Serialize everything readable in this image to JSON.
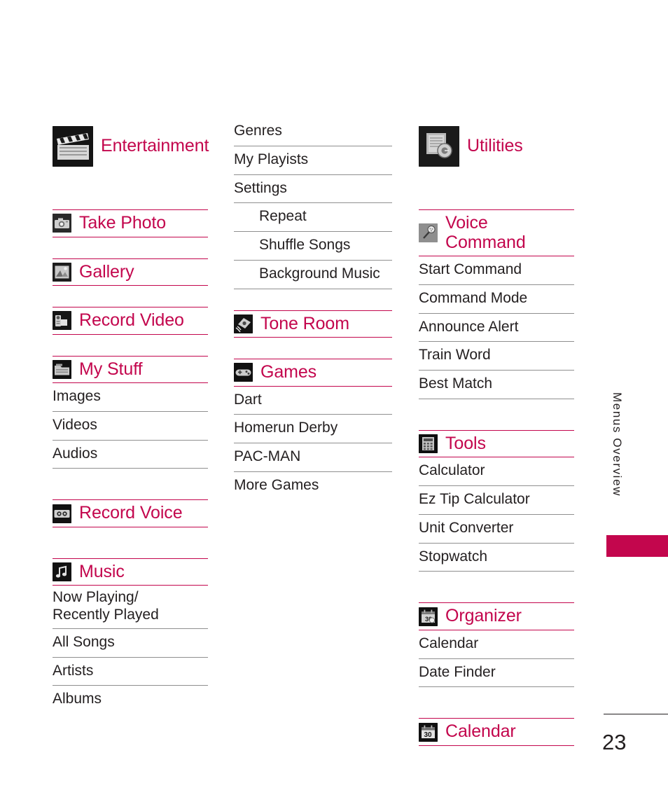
{
  "page": {
    "number": "23",
    "side_label": "Menus Overview",
    "accent_color": "#c3064d",
    "text_color": "#231f20"
  },
  "columns": {
    "left": {
      "sections": [
        {
          "type": "header",
          "size": "large",
          "icon": "clapperboard-icon",
          "title": "Entertainment",
          "rules": "none"
        },
        {
          "type": "header",
          "size": "small",
          "icon": "camera-icon",
          "title": "Take Photo",
          "rules": "both"
        },
        {
          "type": "header",
          "size": "small",
          "icon": "gallery-icon",
          "title": "Gallery",
          "rules": "both"
        },
        {
          "type": "header",
          "size": "small",
          "icon": "camcorder-icon",
          "title": "Record Video",
          "rules": "both"
        },
        {
          "type": "header",
          "size": "small",
          "icon": "folder-icon",
          "title": "My Stuff",
          "rules": "both"
        },
        {
          "type": "items",
          "items": [
            {
              "label": "Images",
              "indent": false
            },
            {
              "label": "Videos",
              "indent": false
            },
            {
              "label": "Audios",
              "indent": false
            }
          ]
        },
        {
          "type": "header",
          "size": "small",
          "icon": "cassette-icon",
          "title": "Record Voice",
          "rules": "both"
        },
        {
          "type": "header",
          "size": "small",
          "icon": "music-note-icon",
          "title": "Music",
          "rules": "both"
        },
        {
          "type": "items",
          "items": [
            {
              "label": "Now Playing/\nRecently Played",
              "indent": false
            },
            {
              "label": "All Songs",
              "indent": false
            },
            {
              "label": "Artists",
              "indent": false
            },
            {
              "label": "Albums",
              "indent": false
            }
          ]
        }
      ]
    },
    "middle": {
      "sections": [
        {
          "type": "items",
          "items": [
            {
              "label": "Genres",
              "indent": false
            },
            {
              "label": "My Playists",
              "indent": false
            },
            {
              "label": "Settings",
              "indent": false
            },
            {
              "label": "Repeat",
              "indent": true
            },
            {
              "label": "Shuffle Songs",
              "indent": true
            },
            {
              "label": "Background Music",
              "indent": true
            }
          ]
        },
        {
          "type": "header",
          "size": "small",
          "icon": "tone-room-icon",
          "title": "Tone Room",
          "rules": "both"
        },
        {
          "type": "header",
          "size": "small",
          "icon": "gamepad-icon",
          "title": "Games",
          "rules": "both"
        },
        {
          "type": "items",
          "items": [
            {
              "label": "Dart",
              "indent": false
            },
            {
              "label": "Homerun Derby",
              "indent": false
            },
            {
              "label": "PAC-MAN",
              "indent": false
            }
          ]
        },
        {
          "type": "items",
          "items": [
            {
              "label": "More Games",
              "indent": false
            }
          ]
        }
      ]
    },
    "right": {
      "sections": [
        {
          "type": "header",
          "size": "large",
          "icon": "utilities-icon",
          "title": "Utilities",
          "rules": "none"
        },
        {
          "type": "header",
          "size": "small",
          "icon": "microphone-icon",
          "title": "Voice\nCommand",
          "rules": "both"
        },
        {
          "type": "items",
          "items": [
            {
              "label": "Start Command",
              "indent": false
            },
            {
              "label": "Command Mode",
              "indent": false
            },
            {
              "label": "Announce Alert",
              "indent": false
            },
            {
              "label": "Train Word",
              "indent": false
            },
            {
              "label": "Best Match",
              "indent": false
            }
          ]
        },
        {
          "type": "header",
          "size": "small",
          "icon": "calculator-icon",
          "title": "Tools",
          "rules": "both"
        },
        {
          "type": "items",
          "items": [
            {
              "label": "Calculator",
              "indent": false
            },
            {
              "label": "Ez Tip Calculator",
              "indent": false
            },
            {
              "label": "Unit Converter",
              "indent": false
            },
            {
              "label": "Stopwatch",
              "indent": false
            }
          ]
        },
        {
          "type": "header",
          "size": "small",
          "icon": "organizer-icon",
          "title": "Organizer",
          "rules": "both"
        },
        {
          "type": "items",
          "items": [
            {
              "label": "Calendar",
              "indent": false
            },
            {
              "label": "Date Finder",
              "indent": false
            }
          ]
        },
        {
          "type": "header",
          "size": "small",
          "icon": "calendar-icon",
          "title": "Calendar",
          "rules": "both"
        }
      ]
    }
  }
}
